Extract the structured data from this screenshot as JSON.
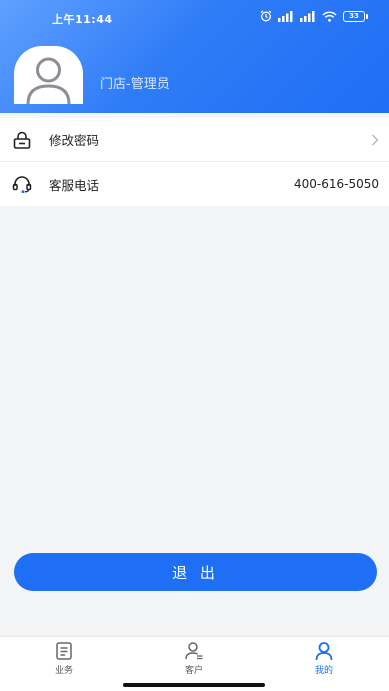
{
  "status_bar": {
    "time": "上午11:44",
    "battery": "33"
  },
  "profile": {
    "role": "门店-管理员",
    "avatar_icon": "user-avatar-icon"
  },
  "menu": {
    "items": [
      {
        "label": "修改密码",
        "icon": "lock-icon",
        "value": "",
        "chevron": true
      },
      {
        "label": "客服电话",
        "icon": "headset-icon",
        "value": "400-616-5050",
        "chevron": false
      }
    ]
  },
  "logout_label": "退 出",
  "tabbar": {
    "tabs": [
      {
        "label": "业务",
        "icon": "document-icon",
        "active": false
      },
      {
        "label": "客户",
        "icon": "customer-icon",
        "active": false
      },
      {
        "label": "我的",
        "icon": "profile-icon",
        "active": true
      }
    ]
  },
  "colors": {
    "accent": "#1e6ff5",
    "header_gradient_start": "#5fa0ff",
    "header_gradient_end": "#1f6ef5",
    "background": "#f4f5f7"
  }
}
